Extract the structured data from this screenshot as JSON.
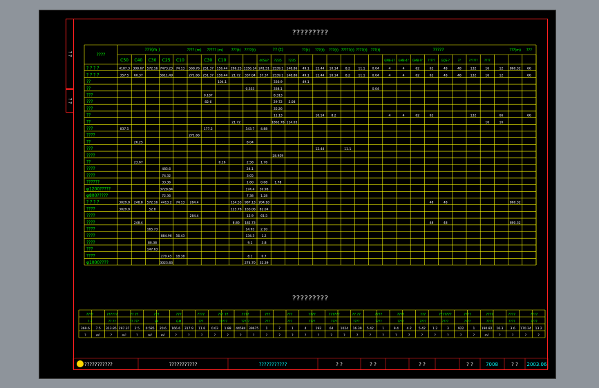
{
  "drawing": {
    "title_top": "?????????",
    "title_bottom": "?????????",
    "side_tab_1": "? ?",
    "side_tab_2": "? ?"
  },
  "top_table": {
    "header": {
      "col0": "????",
      "group1": "???(m )",
      "sub1": [
        "C50",
        "C40",
        "C30",
        "C25",
        "C10"
      ],
      "c7": "???? (m)",
      "group2": "????? (m)",
      "sub2": [
        "C30",
        "C10"
      ],
      "c10": "???(t)",
      "c11": "????(t)",
      "group3": "?? (t)",
      "sub3": [
        "40Si/?",
        "?235",
        "?235"
      ],
      "c15": "??(t)",
      "c16": "???(t)",
      "c17": "???(t)",
      "c18": "?????(t)",
      "c19": "????(t)",
      "c20": "???(t)",
      "group4": "?????",
      "sub4": [
        "GM8-3?",
        "GM8-4?",
        "GM8-??",
        "?????",
        "GQS-?",
        "??",
        "??????",
        "????"
      ],
      "c29": "???(m)",
      "c30": "???"
    },
    "rows": [
      {
        "label": "? ? ? ?",
        "cells": [
          "4187.3",
          "308.67",
          "572.16",
          "7473.23",
          "74.13",
          "568.76",
          "251.37",
          "156.44",
          "296.25",
          "1356.14",
          "241.51",
          "2539.1",
          "148.86",
          "49.1",
          "12.44",
          "10.14",
          "8.2",
          "11.1",
          "0.04",
          "4",
          "4",
          "62",
          "62",
          "48",
          "48",
          "132",
          "16",
          "12",
          "860.32",
          "66"
        ]
      },
      {
        "label": "? ? ? ?",
        "cells": [
          "357.5",
          "60.37",
          "",
          "5611.49",
          "",
          "271.66",
          "251.37",
          "156.44",
          "21.72",
          "337.04",
          "37.37",
          "2539.1",
          "148.86",
          "49.1",
          "12.44",
          "10.14",
          "8.2",
          "11.1",
          "0.04",
          "4",
          "4",
          "62",
          "62",
          "48",
          "48",
          "132",
          "16",
          "12",
          "",
          "66"
        ]
      },
      {
        "label": "??",
        "cells": [
          "",
          "",
          "",
          "",
          "",
          "",
          "",
          "104.1",
          "",
          "",
          "",
          "336.9",
          "",
          "49.1",
          "",
          "",
          "",
          "",
          "",
          "",
          "",
          "",
          "",
          "",
          "",
          "",
          "",
          "",
          "",
          ""
        ]
      },
      {
        "label": "??",
        "cells": [
          "",
          "",
          "",
          "",
          "",
          "",
          "",
          "",
          "",
          "0.333",
          "",
          "338.1",
          "",
          "",
          "",
          "",
          "",
          "",
          "0.04",
          "",
          "",
          "",
          "",
          "",
          "",
          "",
          "",
          "",
          "",
          ""
        ]
      },
      {
        "label": "???",
        "cells": [
          "",
          "",
          "",
          "",
          "",
          "",
          "0.187",
          "",
          "",
          "",
          "",
          "8.313",
          "",
          "",
          "",
          "",
          "",
          "",
          "",
          "",
          "",
          "",
          "",
          "",
          "",
          "",
          "",
          "",
          "",
          ""
        ]
      },
      {
        "label": "???",
        "cells": [
          "",
          "",
          "",
          "",
          "",
          "",
          "82.6",
          "",
          "",
          "",
          "",
          "29.72",
          "5.08",
          "",
          "",
          "",
          "",
          "",
          "",
          "",
          "",
          "",
          "",
          "",
          "",
          "",
          "",
          "",
          "",
          ""
        ]
      },
      {
        "label": "???",
        "cells": [
          "",
          "",
          "",
          "",
          "",
          "",
          "",
          "",
          "",
          "",
          "",
          "35.26",
          "",
          "",
          "",
          "",
          "",
          "",
          "",
          "",
          "",
          "",
          "",
          "",
          "",
          "",
          "",
          "",
          "",
          ""
        ]
      },
      {
        "label": "??",
        "cells": [
          "",
          "",
          "",
          "",
          "",
          "",
          "",
          "",
          "",
          "",
          "",
          "11.13",
          "",
          "",
          "10.14",
          "8.2",
          "",
          "",
          "",
          "4",
          "4",
          "62",
          "62",
          "",
          "",
          "132",
          "",
          "66",
          "",
          "66"
        ]
      },
      {
        "label": "??",
        "cells": [
          "",
          "",
          "",
          "",
          "",
          "",
          "",
          "",
          "21.72",
          "",
          "",
          "1862.78",
          "114.03",
          "",
          "",
          "",
          "",
          "",
          "",
          "",
          "",
          "",
          "",
          "",
          "",
          "",
          "16",
          "16",
          "",
          ""
        ]
      },
      {
        "label": "???",
        "cells": [
          "837.5",
          "",
          "",
          "",
          "",
          "",
          "177.2",
          "",
          "",
          "543.7",
          "4.88",
          "",
          "",
          "",
          "",
          "",
          "",
          "",
          "",
          "",
          "",
          "",
          "",
          "",
          "",
          "",
          "",
          "",
          "",
          ""
        ]
      },
      {
        "label": "????",
        "cells": [
          "",
          "",
          "",
          "",
          "",
          "271.66",
          "",
          "",
          "",
          "",
          "",
          "",
          "",
          "",
          "",
          "",
          "",
          "",
          "",
          "",
          "",
          "",
          "",
          "",
          "",
          "",
          "",
          "",
          "",
          ""
        ]
      },
      {
        "label": "??",
        "cells": [
          "",
          "26.25",
          "",
          "",
          "",
          "",
          "",
          "",
          "",
          "8.04",
          "",
          "",
          "",
          "",
          "",
          "",
          "",
          "",
          "",
          "",
          "",
          "",
          "",
          "",
          "",
          "",
          "",
          "",
          "",
          ""
        ]
      },
      {
        "label": "???",
        "cells": [
          "",
          "",
          "",
          "",
          "",
          "",
          "",
          "",
          "",
          "",
          "",
          "",
          "",
          "",
          "12.44",
          "",
          "11.1",
          "",
          "",
          "",
          "",
          "",
          "",
          "",
          "",
          "",
          "",
          "",
          "",
          ""
        ]
      },
      {
        "label": "????",
        "cells": [
          "",
          "",
          "",
          "",
          "",
          "",
          "",
          "",
          "",
          "",
          "",
          "28.959",
          "",
          "",
          "",
          "",
          "",
          "",
          "",
          "",
          "",
          "",
          "",
          "",
          "",
          "",
          "",
          "",
          "",
          ""
        ]
      },
      {
        "label": "??",
        "cells": [
          "",
          "23.67",
          "",
          "",
          "",
          "",
          "",
          "0.16",
          "",
          "2.58",
          "1.76",
          "",
          "",
          "",
          "",
          "",
          "",
          "",
          "",
          "",
          "",
          "",
          "",
          "",
          "",
          "",
          "",
          "",
          "",
          ""
        ]
      },
      {
        "label": "????",
        "cells": [
          "",
          "",
          "",
          "485.6",
          "",
          "",
          "",
          "",
          "",
          "24.1",
          "",
          "",
          "",
          "",
          "",
          "",
          "",
          "",
          "",
          "",
          "",
          "",
          "",
          "",
          "",
          "",
          "",
          "",
          "",
          ""
        ]
      },
      {
        "label": "????",
        "cells": [
          "",
          "",
          "",
          "74.32",
          "",
          "",
          "",
          "",
          "",
          "3.05",
          "",
          "",
          "",
          "",
          "",
          "",
          "",
          "",
          "",
          "",
          "",
          "",
          "",
          "",
          "",
          "",
          "",
          "",
          "",
          ""
        ]
      },
      {
        "label": "??????",
        "cells": [
          "",
          "",
          "",
          "33.36",
          "",
          "",
          "",
          "",
          "",
          "1.60",
          "0.08",
          "1.78",
          "",
          "",
          "",
          "",
          "",
          "",
          "",
          "",
          "",
          "",
          "",
          "",
          "",
          "",
          "",
          "",
          "",
          ""
        ]
      },
      {
        "label": "φ1200?????",
        "cells": [
          "",
          "",
          "",
          "3728.84",
          "",
          "",
          "",
          "",
          "",
          "174.4",
          "30.98",
          "",
          "",
          "",
          "",
          "",
          "",
          "",
          "",
          "",
          "",
          "",
          "",
          "",
          "",
          "",
          "",
          "",
          "",
          ""
        ]
      },
      {
        "label": "φ800?????",
        "cells": [
          "",
          "",
          "",
          "72.36",
          "",
          "",
          "",
          "",
          "",
          "7.38",
          "1.28",
          "",
          "",
          "",
          "",
          "",
          "",
          "",
          "",
          "",
          "",
          "",
          "",
          "",
          "",
          "",
          "",
          "",
          "",
          ""
        ]
      },
      {
        "label": "? ? ? ?",
        "cells": [
          "3829.8",
          "248.8",
          "572.16",
          "4413.2",
          "74.13",
          "284.4",
          "",
          "",
          "134.53",
          "987.13",
          "204.18",
          "",
          "",
          "",
          "",
          "",
          "",
          "",
          "",
          "",
          "",
          "",
          "48",
          "48",
          "",
          "",
          "",
          "",
          "860.32",
          ""
        ]
      },
      {
        "label": "????",
        "cells": [
          "3829.8",
          "",
          "52.8",
          "",
          "",
          "",
          "",
          "",
          "125.78",
          "163.06",
          "82.04",
          "",
          "",
          "",
          "",
          "",
          "",
          "",
          "",
          "",
          "",
          "",
          "",
          "",
          "",
          "",
          "",
          "",
          "",
          ""
        ]
      },
      {
        "label": "????",
        "cells": [
          "",
          "",
          "",
          "",
          "",
          "284.4",
          "",
          "",
          "",
          "12.9",
          "61.5",
          "",
          "",
          "",
          "",
          "",
          "",
          "",
          "",
          "",
          "",
          "",
          "",
          "",
          "",
          "",
          "",
          "",
          "",
          ""
        ]
      },
      {
        "label": "????",
        "cells": [
          "",
          "248.4",
          "",
          "",
          "",
          "",
          "",
          "",
          "8.86",
          "182.73",
          "",
          "",
          "",
          "",
          "",
          "",
          "",
          "",
          "",
          "",
          "",
          "",
          "48",
          "48",
          "",
          "",
          "",
          "",
          "860.32",
          ""
        ]
      },
      {
        "label": "????",
        "cells": [
          "",
          "",
          "165.73",
          "",
          "",
          "",
          "",
          "",
          "",
          "14.93",
          "2.10",
          "",
          "",
          "",
          "",
          "",
          "",
          "",
          "",
          "",
          "",
          "",
          "",
          "",
          "",
          "",
          "",
          "",
          "",
          ""
        ]
      },
      {
        "label": "????",
        "cells": [
          "",
          "",
          "",
          "884.96",
          "56.43",
          "",
          "",
          "",
          "",
          "134.3",
          "1.2",
          "",
          "",
          "",
          "",
          "",
          "",
          "",
          "",
          "",
          "",
          "",
          "",
          "",
          "",
          "",
          "",
          "",
          "",
          ""
        ]
      },
      {
        "label": "????",
        "cells": [
          "",
          "",
          "86.38",
          "",
          "",
          "",
          "",
          "",
          "",
          "9.1",
          "3.8",
          "",
          "",
          "",
          "",
          "",
          "",
          "",
          "",
          "",
          "",
          "",
          "",
          "",
          "",
          "",
          "",
          "",
          "",
          ""
        ]
      },
      {
        "label": "???",
        "cells": [
          "",
          "",
          "147.63",
          "",
          "",
          "",
          "",
          "",
          "",
          "",
          "",
          "",
          "",
          "",
          "",
          "",
          "",
          "",
          "",
          "",
          "",
          "",
          "",
          "",
          "",
          "",
          "",
          "",
          "",
          ""
        ]
      },
      {
        "label": "????",
        "cells": [
          "",
          "",
          "",
          "279.45",
          "18.38",
          "",
          "",
          "",
          "",
          "8.1",
          "0.7",
          "",
          "",
          "",
          "",
          "",
          "",
          "",
          "",
          "",
          "",
          "",
          "",
          "",
          "",
          "",
          "",
          "",
          "",
          ""
        ]
      },
      {
        "label": "φ1000????",
        "cells": [
          "",
          "",
          "",
          "3023.83",
          "",
          "",
          "",
          "",
          "",
          "274.70",
          "32.39",
          "",
          "",
          "",
          "",
          "",
          "",
          "",
          "",
          "",
          "",
          "",
          "",
          "",
          "",
          "",
          "",
          "",
          "",
          ""
        ]
      }
    ]
  },
  "bottom_table": {
    "row_head": [
      "????",
      "??????",
      "?? ??",
      "???",
      "???",
      "????",
      "??? ??",
      "????",
      "???",
      "???",
      "????",
      "??????",
      "?? ??",
      "????",
      "????",
      "???",
      "???????",
      "????",
      "????",
      "????",
      "????"
    ],
    "row_sub": [
      "? ?",
      "?? ??",
      "?? ???",
      "SP",
      "GM",
      "???",
      "?????",
      "?????",
      "???",
      "???",
      "????",
      "????",
      "????",
      "????",
      "????",
      "????",
      "????",
      "????",
      "????",
      "????",
      "????"
    ],
    "row_vals": [
      "369.6",
      "7.5",
      "313.85",
      "297.37",
      "2.5",
      "0.585",
      "20.6",
      "166.6",
      "317.9",
      "11.6",
      "0.03",
      "1.88",
      "44584",
      "39675",
      "1",
      "?",
      "1",
      "4",
      "192",
      "64",
      "1024",
      "16.39",
      "5.42",
      "1",
      "9.4",
      "4.2",
      "5.42",
      "1.2",
      "3",
      "922",
      "1",
      "190.82",
      "16.3",
      "3.6",
      "170.34",
      "13.2"
    ],
    "row_units": [
      "?",
      "m²",
      "?",
      "m²",
      "?",
      "m²",
      "m²",
      "?",
      "?",
      "?",
      "?",
      "?",
      "?",
      "?",
      "?",
      "?",
      "?",
      "?",
      "?",
      "?",
      "?",
      "?",
      "?",
      "?",
      "?",
      "?",
      "?",
      "?",
      "?",
      "?",
      "?",
      "m²",
      "?",
      "?",
      "?",
      "?"
    ]
  },
  "title_block": {
    "company": "???????????",
    "project": "???????????",
    "drawing_name": "???????????",
    "label_a": "? ?",
    "label_b": "? ?",
    "label_c": "? ?",
    "label_d": "? ?",
    "drawing_no": "7008",
    "label_e": "? ?",
    "date": "2003.06"
  },
  "colors": {
    "background": "#8e949b",
    "sheet": "#000000",
    "frame": "#ff1f1f",
    "table_grid": "#ffff00",
    "header_text": "#00ff00",
    "cell_text": "#ffffff",
    "title_block_text": "#00ffff",
    "logo": "#ffd700"
  }
}
